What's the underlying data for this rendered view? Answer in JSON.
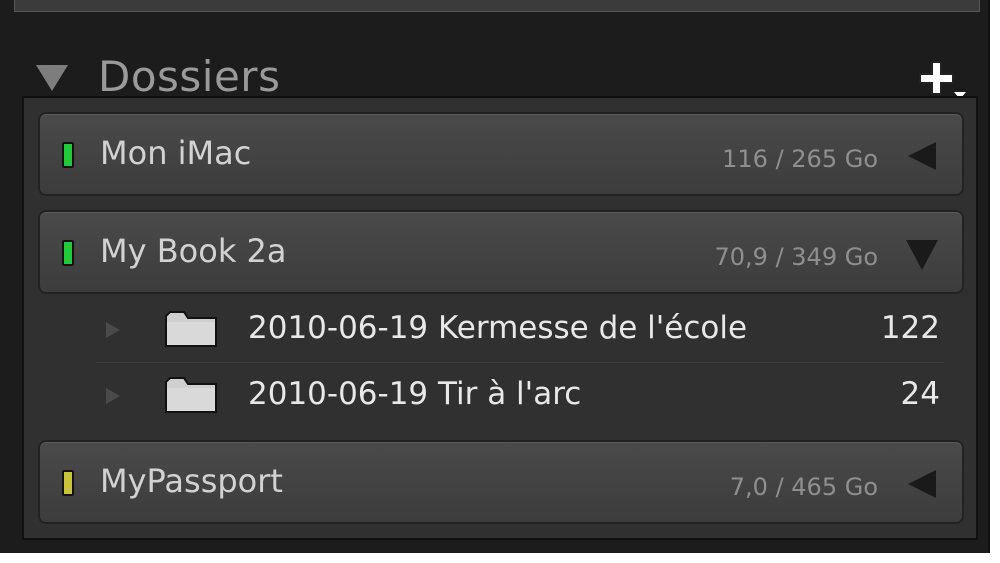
{
  "panel": {
    "title": "Dossiers",
    "add_icon": "plus-dropdown-icon"
  },
  "volumes": [
    {
      "name": "Mon iMac",
      "size": "116 / 265 Go",
      "status_color": "#22c93a",
      "expanded": false
    },
    {
      "name": "My Book 2a",
      "size": "70,9 / 349 Go",
      "status_color": "#22c93a",
      "expanded": true,
      "folders": [
        {
          "name": "2010-06-19 Kermesse de l'école",
          "count": "122"
        },
        {
          "name": "2010-06-19 Tir à l'arc",
          "count": "24"
        }
      ]
    },
    {
      "name": "MyPassport",
      "size": "7,0 / 465 Go",
      "status_color": "#c9c23a",
      "expanded": false
    }
  ]
}
